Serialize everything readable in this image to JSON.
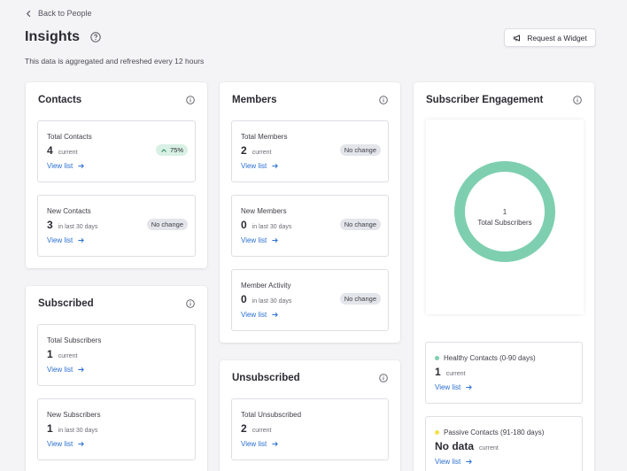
{
  "header": {
    "back_label": "Back to People",
    "title": "Insights",
    "subtitle": "This data is aggregated and refreshed every 12 hours",
    "request_label": "Request a Widget"
  },
  "colors": {
    "accent": "#2a6fd1",
    "donut": "#7ecfaf",
    "healthy": "#7ecfaf",
    "passive": "#f2e14b"
  },
  "contacts": {
    "title": "Contacts",
    "total": {
      "label": "Total Contacts",
      "value": "4",
      "sub": "current",
      "badge": "75%",
      "link": "View list"
    },
    "new": {
      "label": "New Contacts",
      "value": "3",
      "sub": "in last 30 days",
      "badge": "No change",
      "link": "View list"
    }
  },
  "subscribed": {
    "title": "Subscribed",
    "total": {
      "label": "Total Subscribers",
      "value": "1",
      "sub": "current",
      "link": "View list"
    },
    "new": {
      "label": "New Subscribers",
      "value": "1",
      "sub": "in last 30 days",
      "link": "View list"
    }
  },
  "members": {
    "title": "Members",
    "total": {
      "label": "Total Members",
      "value": "2",
      "sub": "current",
      "badge": "No change",
      "link": "View list"
    },
    "new": {
      "label": "New Members",
      "value": "0",
      "sub": "in last 30 days",
      "badge": "No change",
      "link": "View list"
    },
    "activity": {
      "label": "Member Activity",
      "value": "0",
      "sub": "in last 30 days",
      "badge": "No change",
      "link": "View list"
    }
  },
  "unsubscribed": {
    "title": "Unsubscribed",
    "total": {
      "label": "Total Unsubscribed",
      "value": "2",
      "sub": "current",
      "link": "View list"
    }
  },
  "engagement": {
    "title": "Subscriber Engagement",
    "donut_value": "1",
    "donut_label": "Total Subscribers",
    "healthy": {
      "label": "Healthy Contacts (0-90 days)",
      "value": "1",
      "sub": "current",
      "link": "View list"
    },
    "passive": {
      "label": "Passive Contacts (91-180 days)",
      "value": "No data",
      "sub": "current",
      "link": "View list"
    }
  }
}
